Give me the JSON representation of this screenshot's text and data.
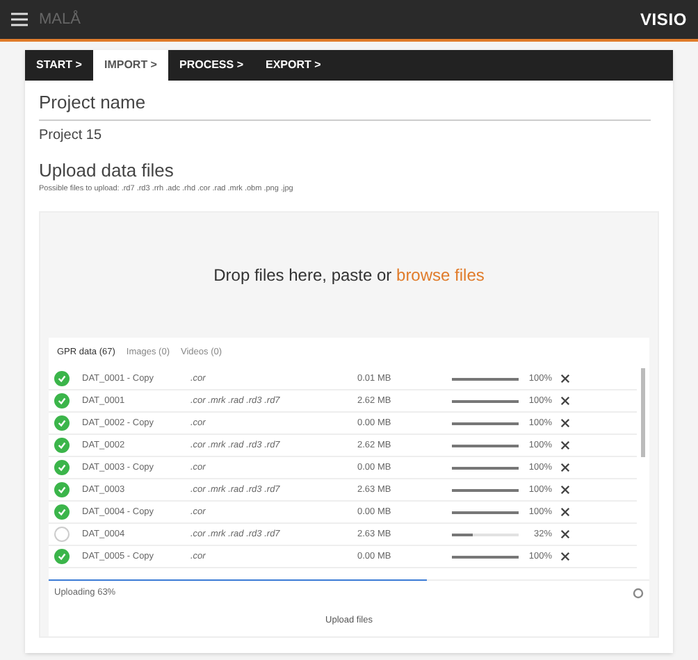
{
  "header": {
    "logo": "MALÅ",
    "brand": "VISIO"
  },
  "steps": [
    {
      "label": "START >",
      "selected": false
    },
    {
      "label": "IMPORT >",
      "selected": true
    },
    {
      "label": "PROCESS >",
      "selected": false
    },
    {
      "label": "EXPORT >",
      "selected": false
    }
  ],
  "project": {
    "label": "Project name",
    "value": "Project 15"
  },
  "upload": {
    "title": "Upload data files",
    "hint": "Possible files to upload: .rd7 .rd3 .rrh .adc .rhd .cor .rad .mrk .obm .png .jpg",
    "drop_text": "Drop files here, paste or ",
    "drop_link": "browse files",
    "tabs": [
      {
        "label": "GPR data (67)",
        "selected": true
      },
      {
        "label": "Images (0)",
        "selected": false
      },
      {
        "label": "Videos (0)",
        "selected": false
      }
    ],
    "files": [
      {
        "name": "DAT_0001 - Copy",
        "ext": ".cor",
        "size": "0.01 MB",
        "level": 1,
        "percent": "100%",
        "done": true
      },
      {
        "name": "DAT_0001",
        "ext": ".cor .mrk .rad .rd3 .rd7",
        "size": "2.62 MB",
        "level": 1,
        "percent": "100%",
        "done": true
      },
      {
        "name": "DAT_0002 - Copy",
        "ext": ".cor",
        "size": "0.00 MB",
        "level": 1,
        "percent": "100%",
        "done": true
      },
      {
        "name": "DAT_0002",
        "ext": ".cor .mrk .rad .rd3 .rd7",
        "size": "2.62 MB",
        "level": 1,
        "percent": "100%",
        "done": true
      },
      {
        "name": "DAT_0003 - Copy",
        "ext": ".cor",
        "size": "0.00 MB",
        "level": 1,
        "percent": "100%",
        "done": true
      },
      {
        "name": "DAT_0003",
        "ext": ".cor .mrk .rad .rd3 .rd7",
        "size": "2.63 MB",
        "level": 1,
        "percent": "100%",
        "done": true
      },
      {
        "name": "DAT_0004 - Copy",
        "ext": ".cor",
        "size": "0.00 MB",
        "level": 1,
        "percent": "100%",
        "done": true
      },
      {
        "name": "DAT_0004",
        "ext": ".cor .mrk .rad .rd3 .rd7",
        "size": "2.63 MB",
        "level": 0.32,
        "percent": "32%",
        "done": false
      },
      {
        "name": "DAT_0005 - Copy",
        "ext": ".cor",
        "size": "0.00 MB",
        "level": 1,
        "percent": "100%",
        "done": true
      }
    ],
    "status": {
      "text": "Uploading 63%",
      "level": 0.63
    },
    "button": "Upload files"
  }
}
